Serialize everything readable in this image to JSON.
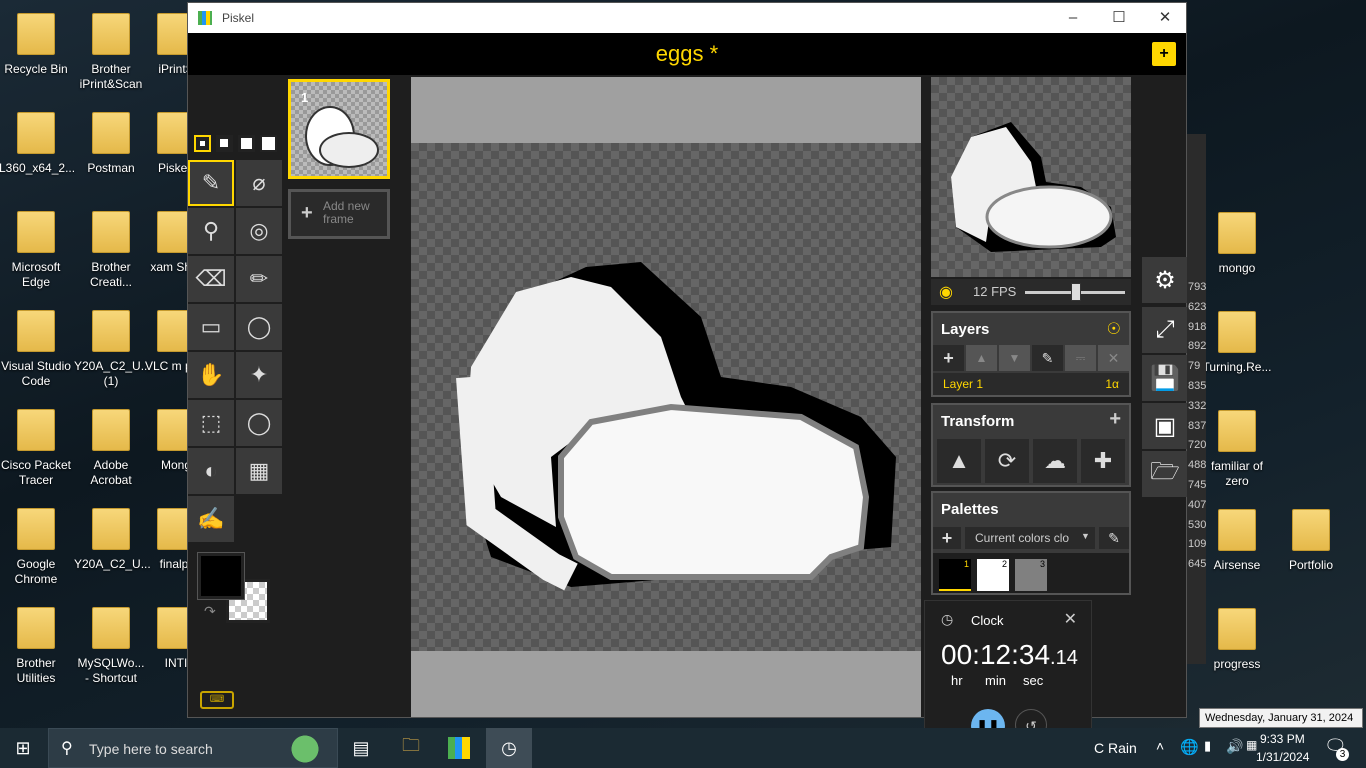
{
  "desktop": {
    "left_icons": [
      {
        "label": "Recycle Bin",
        "icon": "recycle-bin-icon"
      },
      {
        "label": "Brother iPrint&Scan",
        "icon": "printer-icon"
      },
      {
        "label": "iPrintS",
        "icon": "printer-icon"
      },
      {
        "label": "L360_x64_2...",
        "icon": "installer-icon"
      },
      {
        "label": "Postman",
        "icon": "postman-icon"
      },
      {
        "label": "Piskel-",
        "icon": "folder-icon"
      },
      {
        "label": "Microsoft Edge",
        "icon": "edge-icon"
      },
      {
        "label": "Brother Creati...",
        "icon": "brother-creative-icon"
      },
      {
        "label": "xam Shor",
        "icon": "folder-icon"
      },
      {
        "label": "Visual Studio Code",
        "icon": "vscode-icon"
      },
      {
        "label": "Y20A_C2_U... (1)",
        "icon": "zip-icon"
      },
      {
        "label": "VLC m play",
        "icon": "vlc-icon"
      },
      {
        "label": "Cisco Packet Tracer",
        "icon": "cisco-icon"
      },
      {
        "label": "Adobe Acrobat",
        "icon": "acrobat-icon"
      },
      {
        "label": "Mong",
        "icon": "mongodb-icon"
      },
      {
        "label": "Google Chrome",
        "icon": "chrome-icon"
      },
      {
        "label": "Y20A_C2_U...",
        "icon": "folder-icon"
      },
      {
        "label": "finalpr",
        "icon": "folder-icon"
      },
      {
        "label": "Brother Utilities",
        "icon": "brother-utilities-icon"
      },
      {
        "label": "MySQLWo... - Shortcut",
        "icon": "mysql-icon"
      },
      {
        "label": "INTI",
        "icon": "word-icon"
      }
    ],
    "right_icons": [
      {
        "label": "mongo",
        "icon": "folder-icon"
      },
      {
        "label": "Turning.Re...",
        "icon": "video-icon"
      },
      {
        "label": "familiar of zero",
        "icon": "folder-icon"
      },
      {
        "label": "Airsense",
        "icon": "folder-icon"
      },
      {
        "label": "Portfolio",
        "icon": "folder-icon"
      },
      {
        "label": "progress",
        "icon": "folder-icon"
      }
    ],
    "partial_numbers": [
      "793",
      "623",
      "918",
      "892",
      "79",
      "835",
      "332",
      "837",
      "720",
      "488",
      "745",
      "407",
      "530",
      "109",
      "645"
    ]
  },
  "piskel": {
    "window_title": "Piskel",
    "document_name": "eggs *",
    "frame_number": "1",
    "add_frame_label": "Add new frame",
    "fps_label": "12 FPS",
    "fps_value": 12,
    "layers_title": "Layers",
    "layer_name": "Layer 1",
    "layer_opacity": "1α",
    "transform_title": "Transform",
    "palettes_title": "Palettes",
    "palette_select": "Current colors clo",
    "swatches": [
      {
        "num": "1",
        "color": "#000000"
      },
      {
        "num": "2",
        "color": "#ffffff"
      },
      {
        "num": "3",
        "color": "#808080"
      }
    ],
    "primary_color": "#000000",
    "accent": "#ffd700"
  },
  "clock": {
    "title": "Clock",
    "hours": "00",
    "minutes": "12",
    "seconds": "34",
    "fraction": ".14",
    "hr_label": "hr",
    "min_label": "min",
    "sec_label": "sec"
  },
  "taskbar": {
    "search_placeholder": "Type here to search",
    "weather": "C Rain",
    "time": "9:33 PM",
    "date": "1/31/2024",
    "notifications": "3",
    "tooltip": "Wednesday, January 31, 2024"
  }
}
